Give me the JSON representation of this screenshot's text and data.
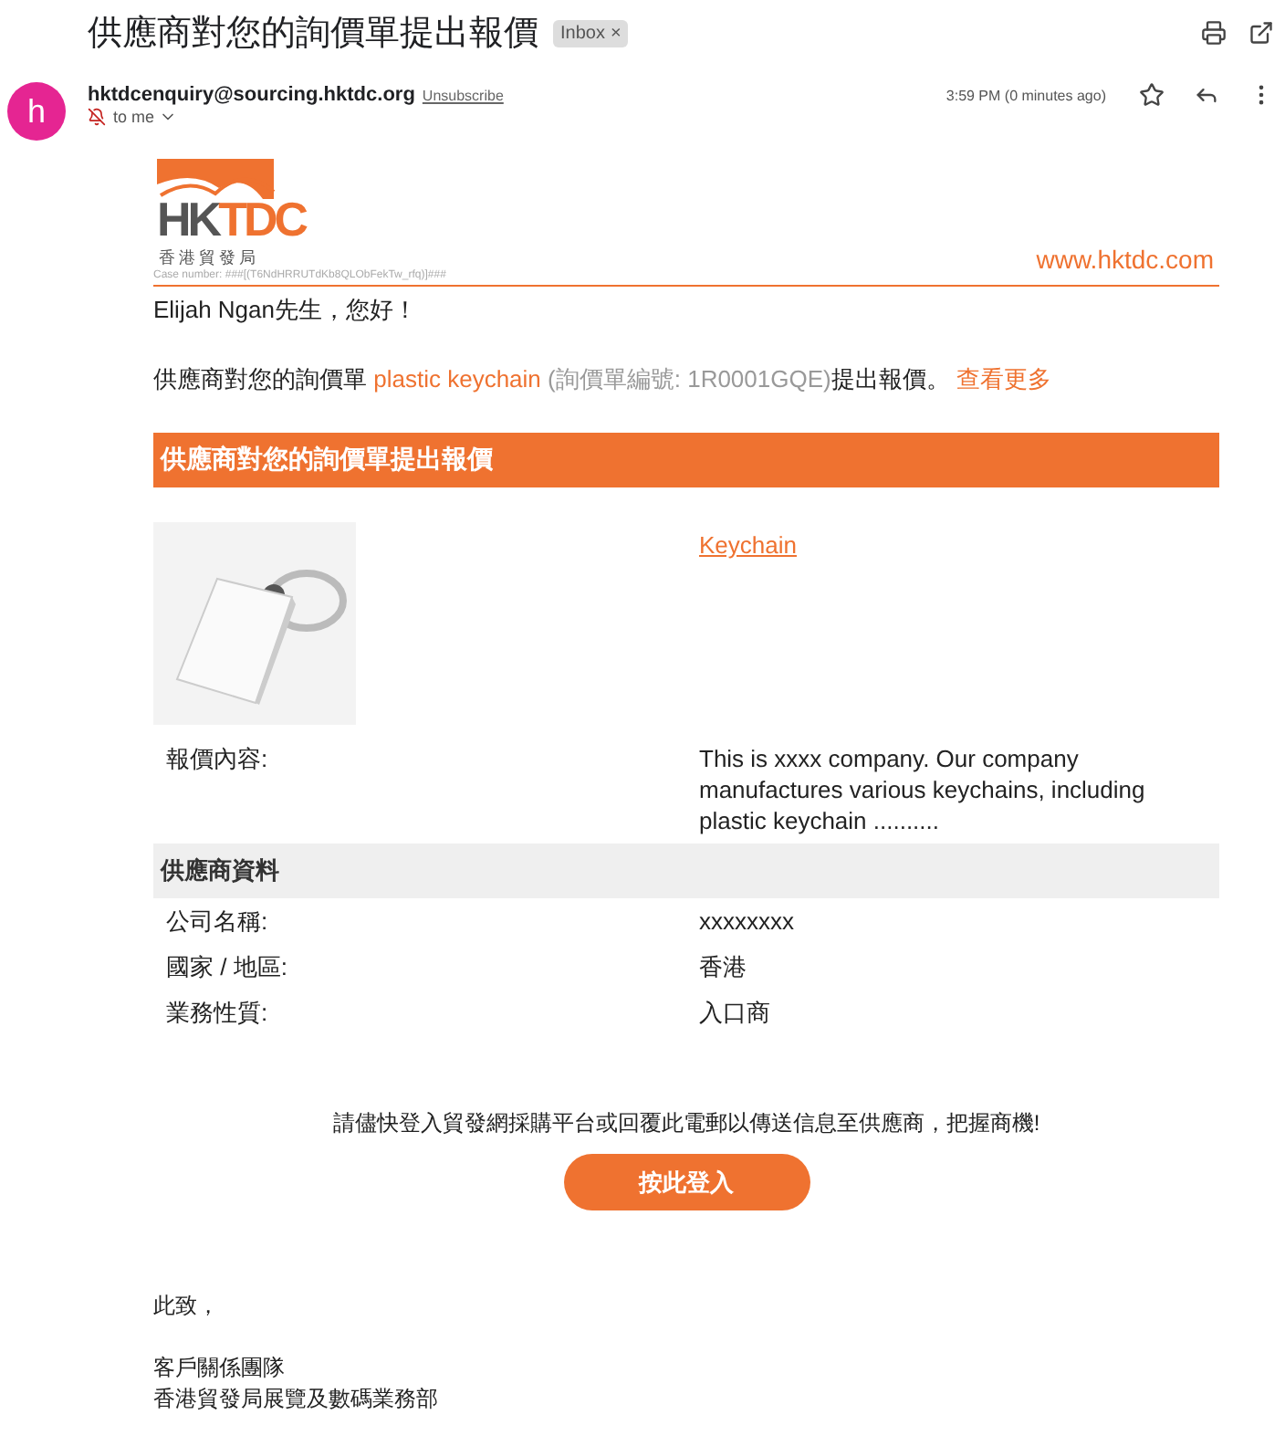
{
  "subject": "供應商對您的詢價單提出報價",
  "label": {
    "text": "Inbox",
    "close": "×"
  },
  "sender": {
    "avatar": "h",
    "email": "hktdcenquiry@sourcing.hktdc.org",
    "unsubscribe": "Unsubscribe",
    "to": "to me",
    "time": "3:59 PM (0 minutes ago)",
    "starred": false
  },
  "logo": {
    "letters_grey": "HK",
    "letters_orange": "TDC",
    "chinese": "香港貿發局"
  },
  "case_number": "Case number: ###[(T6NdHRRUTdKb8QLObFekTw_rfq)]###",
  "website": "www.hktdc.com",
  "greeting": "Elijah Ngan先生，您好！",
  "intro": {
    "before": "供應商對您的詢價單",
    "product": "plastic keychain",
    "ref": "(詢價單編號: 1R0001GQE)",
    "after": "提出報價。",
    "more": "查看更多"
  },
  "banner": "供應商對您的詢價單提出報價",
  "product_link": "Keychain",
  "quote": {
    "label": "報價內容:",
    "text": "This is xxxx company. Our company manufactures various keychains, including plastic keychain .........."
  },
  "supplier_heading": "供應商資料",
  "supplier_rows": [
    {
      "label": "公司名稱:",
      "value": "xxxxxxxx"
    },
    {
      "label": "國家 / 地區:",
      "value": "香港"
    },
    {
      "label": "業務性質:",
      "value": "入口商"
    }
  ],
  "prompt": "請儘快登入貿發網採購平台或回覆此電郵以傳送信息至供應商，把握商機!",
  "login_button": "按此登入",
  "closing": "此致，",
  "signature": [
    "客戶關係團隊",
    "香港貿發局展覽及數碼業務部"
  ]
}
